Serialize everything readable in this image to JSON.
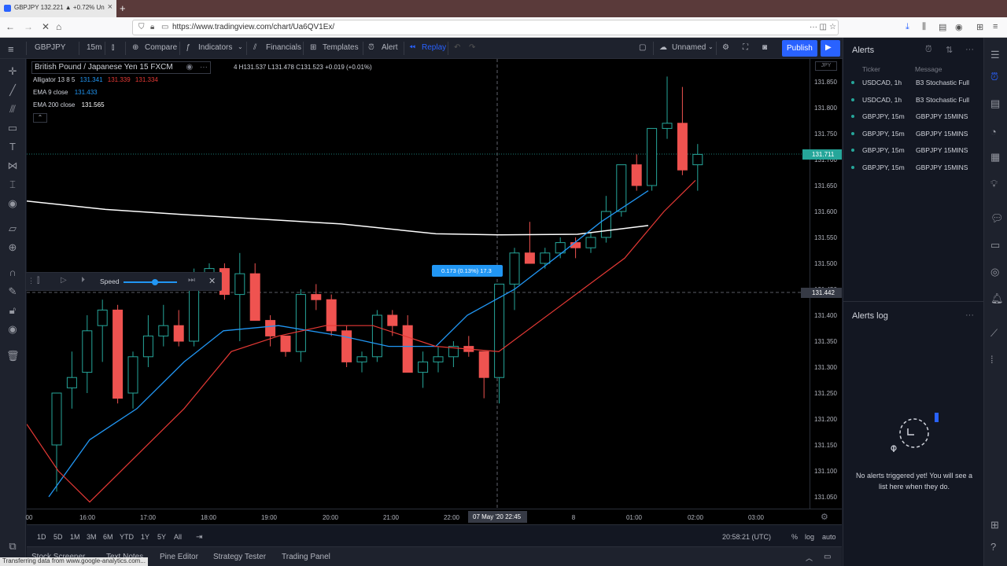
{
  "browser": {
    "tab_title": "GBPJPY 132.221 ▲ +0.72% Un",
    "url": "https://www.tradingview.com/chart/Ua6QV1Ex/",
    "status": "Transferring data from www.google-analytics.com..."
  },
  "toolbar": {
    "symbol": "GBPJPY",
    "interval": "15m",
    "compare": "Compare",
    "indicators": "Indicators",
    "financials": "Financials",
    "templates": "Templates",
    "alert": "Alert",
    "replay": "Replay",
    "layout_name": "Unnamed",
    "publish": "Publish"
  },
  "legend": {
    "title": "British Pound / Japanese Yen  15  FXCM",
    "ohlc": "4  H131.537  L131.478  C131.523  +0.019 (+0.01%)",
    "alligator_label": "Alligator 13 8 5",
    "alligator_v1": "131.341",
    "alligator_v2": "131.339",
    "alligator_v3": "131.334",
    "ema9_label": "EMA 9 close",
    "ema9_value": "131.433",
    "ema200_label": "EMA 200 close",
    "ema200_value": "131.565"
  },
  "replay_bar": {
    "speed_label": "Speed"
  },
  "measure_label": "0.173 (0.13%) 17.3",
  "crosshair": {
    "price": "131.442",
    "time_label": "07 May '20   22:45"
  },
  "last_price": "131.711",
  "currency": "JPY",
  "price_axis": [
    "131.850",
    "131.800",
    "131.750",
    "131.700",
    "131.650",
    "131.600",
    "131.550",
    "131.500",
    "131.450",
    "131.400",
    "131.350",
    "131.300",
    "131.250",
    "131.200",
    "131.150",
    "131.100",
    "131.050"
  ],
  "time_axis": [
    "00",
    "16:00",
    "17:00",
    "18:00",
    "19:00",
    "20:00",
    "21:00",
    "22:00",
    "8",
    "01:00",
    "02:00",
    "03:00"
  ],
  "bottom": {
    "ranges": [
      "1D",
      "5D",
      "1M",
      "3M",
      "6M",
      "YTD",
      "1Y",
      "5Y",
      "All"
    ],
    "clock": "20:58:21 (UTC)",
    "pct": "%",
    "log": "log",
    "auto": "auto",
    "tabs": [
      "Stock Screener",
      "Text Notes",
      "Pine Editor",
      "Strategy Tester",
      "Trading Panel"
    ]
  },
  "alerts": {
    "title": "Alerts",
    "col_ticker": "Ticker",
    "col_message": "Message",
    "rows": [
      {
        "ticker": "USDCAD, 1h",
        "message": "B3 Stochastic Full"
      },
      {
        "ticker": "USDCAD, 1h",
        "message": "B3 Stochastic Full"
      },
      {
        "ticker": "GBPJPY, 15m",
        "message": "GBPJPY 15MINS"
      },
      {
        "ticker": "GBPJPY, 15m",
        "message": "GBPJPY 15MINS"
      },
      {
        "ticker": "GBPJPY, 15m",
        "message": "GBPJPY 15MINS"
      },
      {
        "ticker": "GBPJPY, 15m",
        "message": "GBPJPY 15MINS"
      }
    ],
    "log_title": "Alerts log",
    "empty_message": "No alerts triggered yet! You will see a list here when they do."
  },
  "colors": {
    "up": "#000000",
    "up_border": "#26a69a",
    "down": "#ef5350",
    "ema9": "#2196f3",
    "ema200": "#ffffff",
    "alligator_red": "#e53935",
    "accent": "#2962ff"
  }
}
